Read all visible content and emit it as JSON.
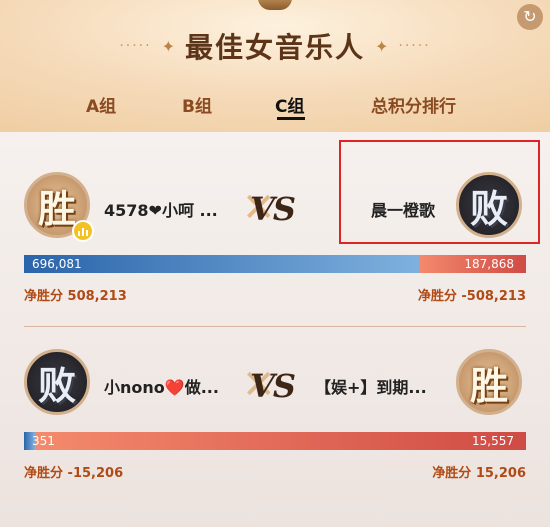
{
  "header": {
    "title": "最佳女音乐人",
    "decor_dots": "·····",
    "decor_star": "✦",
    "refresh_icon": "↻"
  },
  "tabs": [
    {
      "label": "A组",
      "active": false
    },
    {
      "label": "B组",
      "active": false
    },
    {
      "label": "C组",
      "active": true
    },
    {
      "label": "总积分排行",
      "active": false
    }
  ],
  "matches": [
    {
      "left": {
        "name": "4578❤小呵 ...",
        "result": "胜",
        "score": "696,081",
        "net_label": "净胜分",
        "net": "508,213"
      },
      "right": {
        "name": "晨一橙歌",
        "result": "败",
        "score": "187,868",
        "net_label": "净胜分",
        "net": "-508,213"
      },
      "vs": "VS",
      "left_share": 0.787
    },
    {
      "left": {
        "name": "小nono❤️做...",
        "result": "败",
        "score": "351",
        "net_label": "净胜分",
        "net": "-15,206"
      },
      "right": {
        "name": "【娱+】到期...",
        "result": "胜",
        "score": "15,557",
        "net_label": "净胜分",
        "net": "15,206"
      },
      "vs": "VS",
      "left_share": 0.022
    }
  ],
  "colors": {
    "left_bar": "#2a64aa",
    "right_bar": "#cf4b45",
    "net_text": "#b14a14",
    "highlight": "#e02424"
  }
}
